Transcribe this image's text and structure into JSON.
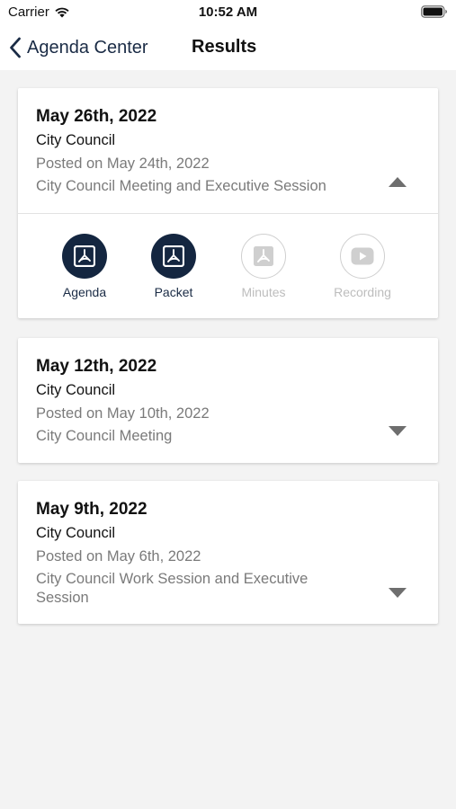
{
  "status_bar": {
    "carrier": "Carrier",
    "time": "10:52 AM"
  },
  "nav": {
    "back_label": "Agenda Center",
    "title": "Results"
  },
  "colors": {
    "accent": "#142640",
    "muted": "#7a7a7a",
    "disabled": "#bdbdbd",
    "background": "#f3f3f3"
  },
  "meetings": [
    {
      "date": "May 26th, 2022",
      "body": "City Council",
      "posted": "Posted on May 24th, 2022",
      "description": "City Council Meeting and Executive Session",
      "expanded": true,
      "documents": [
        {
          "label": "Agenda",
          "icon": "pdf-icon",
          "available": true
        },
        {
          "label": "Packet",
          "icon": "pdf-icon",
          "available": true
        },
        {
          "label": "Minutes",
          "icon": "pdf-icon",
          "available": false
        },
        {
          "label": "Recording",
          "icon": "play-icon",
          "available": false
        }
      ]
    },
    {
      "date": "May 12th, 2022",
      "body": "City Council",
      "posted": "Posted on May 10th, 2022",
      "description": "City Council Meeting",
      "expanded": false
    },
    {
      "date": "May 9th, 2022",
      "body": "City Council",
      "posted": "Posted on May 6th, 2022",
      "description": "City Council Work Session and Executive Session",
      "expanded": false
    }
  ]
}
